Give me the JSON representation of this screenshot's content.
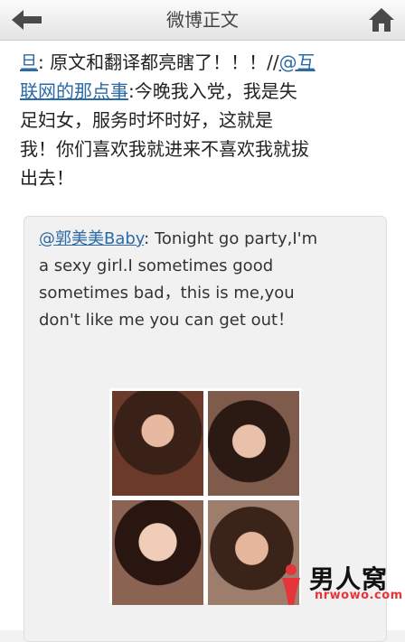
{
  "header": {
    "title": "微博正文",
    "back_icon": "back-arrow-icon",
    "home_icon": "home-icon"
  },
  "post": {
    "line1_prefix_link": "旦",
    "line1_text": ": 原文和翻译都亮瞎了！！！//",
    "mention_link_a": "@互",
    "mention_link_b": "联网的那点事",
    "rest_a": ":今晚我入党，我是失",
    "rest_b": "足妇女，服务时坏时好，这就是",
    "rest_c": "我！你们喜欢我就进来不喜欢我就拔",
    "rest_d": "出去！"
  },
  "retweet": {
    "author": "@郭美美Baby",
    "text_a": ":  Tonight go party,I'm",
    "text_b": "a sexy girl.I sometimes good",
    "text_c": "sometimes bad，this is me,you",
    "text_d": "don't like me you can get out！",
    "photos": [
      "photo-1",
      "photo-2",
      "photo-3",
      "photo-4"
    ]
  },
  "watermark": {
    "cn": "男人窝",
    "en": "nrwowo.com",
    "accent": "#e6353a"
  }
}
